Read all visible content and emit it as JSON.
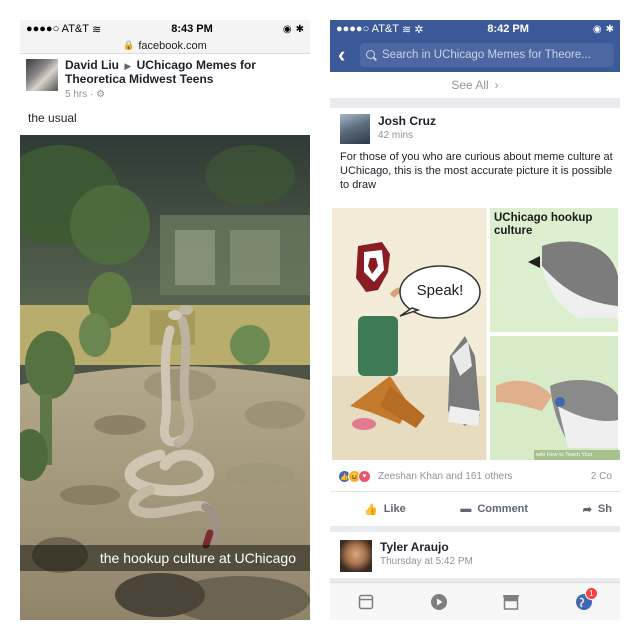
{
  "left": {
    "status": {
      "carrier": "●●●●○ AT&T",
      "time": "8:43 PM"
    },
    "url": "facebook.com",
    "post": {
      "author": "David Liu",
      "group": "UChicago Memes for Theoretica Midwest Teens",
      "meta": "5 hrs ·",
      "caption": "the usual",
      "photo_caption": "the hookup culture at UChicago"
    }
  },
  "right": {
    "status": {
      "carrier": "●●●●○ AT&T",
      "time": "8:42 PM"
    },
    "search_placeholder": "Search in UChicago Memes for Theore...",
    "see_all": "See All",
    "post": {
      "author": "Josh Cruz",
      "time": "42 mins",
      "body": "For those of you who are curious about meme culture at UChicago, this is the most accurate picture it is possible to draw",
      "meme_title": "UChicago hookup culture",
      "meme_speech": "Speak!",
      "watermark": "wiki How to Teach Your",
      "reactions_text": "Zeeshan Khan and 161 others",
      "comments": "2 Co",
      "like_label": "Like",
      "comment_label": "Comment",
      "share_label": "Sh"
    },
    "post2": {
      "author": "Tyler Araujo",
      "time": "Thursday at 5:42 PM"
    },
    "tabs": [
      "news-feed-icon",
      "video-icon",
      "marketplace-icon",
      "notifications-globe-icon"
    ],
    "notification_count": "1"
  },
  "colors": {
    "fb_blue": "#3b5998",
    "search_bg": "#4c67a1",
    "badge_red": "#fa3e3e",
    "uchicago_maroon": "#8a1c24"
  }
}
